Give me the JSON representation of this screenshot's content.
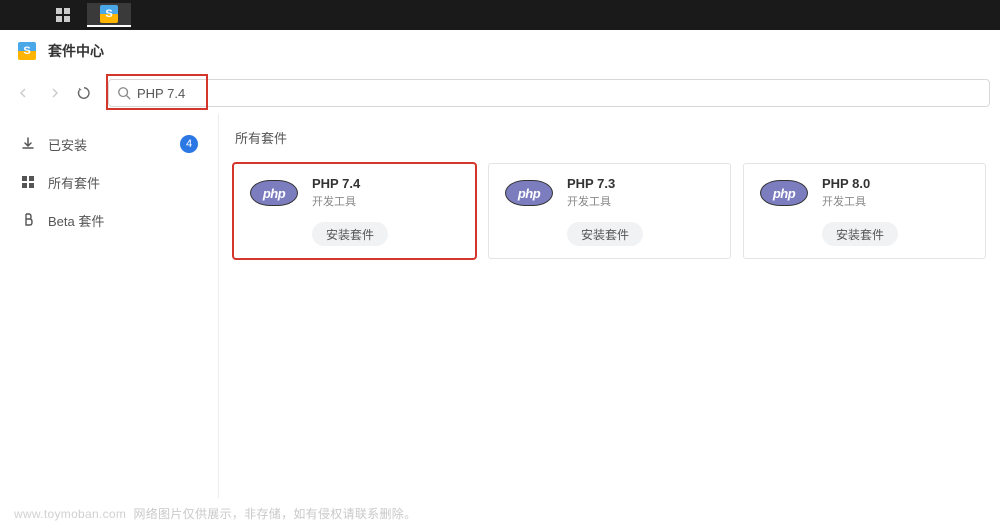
{
  "header": {
    "title": "套件中心"
  },
  "toolbar": {
    "search_value": "PHP 7.4"
  },
  "sidebar": {
    "items": [
      {
        "icon": "download",
        "label": "已安装",
        "badge": "4"
      },
      {
        "icon": "grid",
        "label": "所有套件"
      },
      {
        "icon": "beta",
        "label": "Beta 套件"
      }
    ]
  },
  "main": {
    "heading": "所有套件",
    "packages": [
      {
        "title": "PHP 7.4",
        "subtitle": "开发工具",
        "action": "安装套件",
        "highlighted": true
      },
      {
        "title": "PHP 7.3",
        "subtitle": "开发工具",
        "action": "安装套件",
        "highlighted": false
      },
      {
        "title": "PHP 8.0",
        "subtitle": "开发工具",
        "action": "安装套件",
        "highlighted": false
      }
    ]
  },
  "footer": {
    "domain": "www.toymoban.com",
    "note": "网络图片仅供展示，非存储，如有侵权请联系删除。"
  }
}
